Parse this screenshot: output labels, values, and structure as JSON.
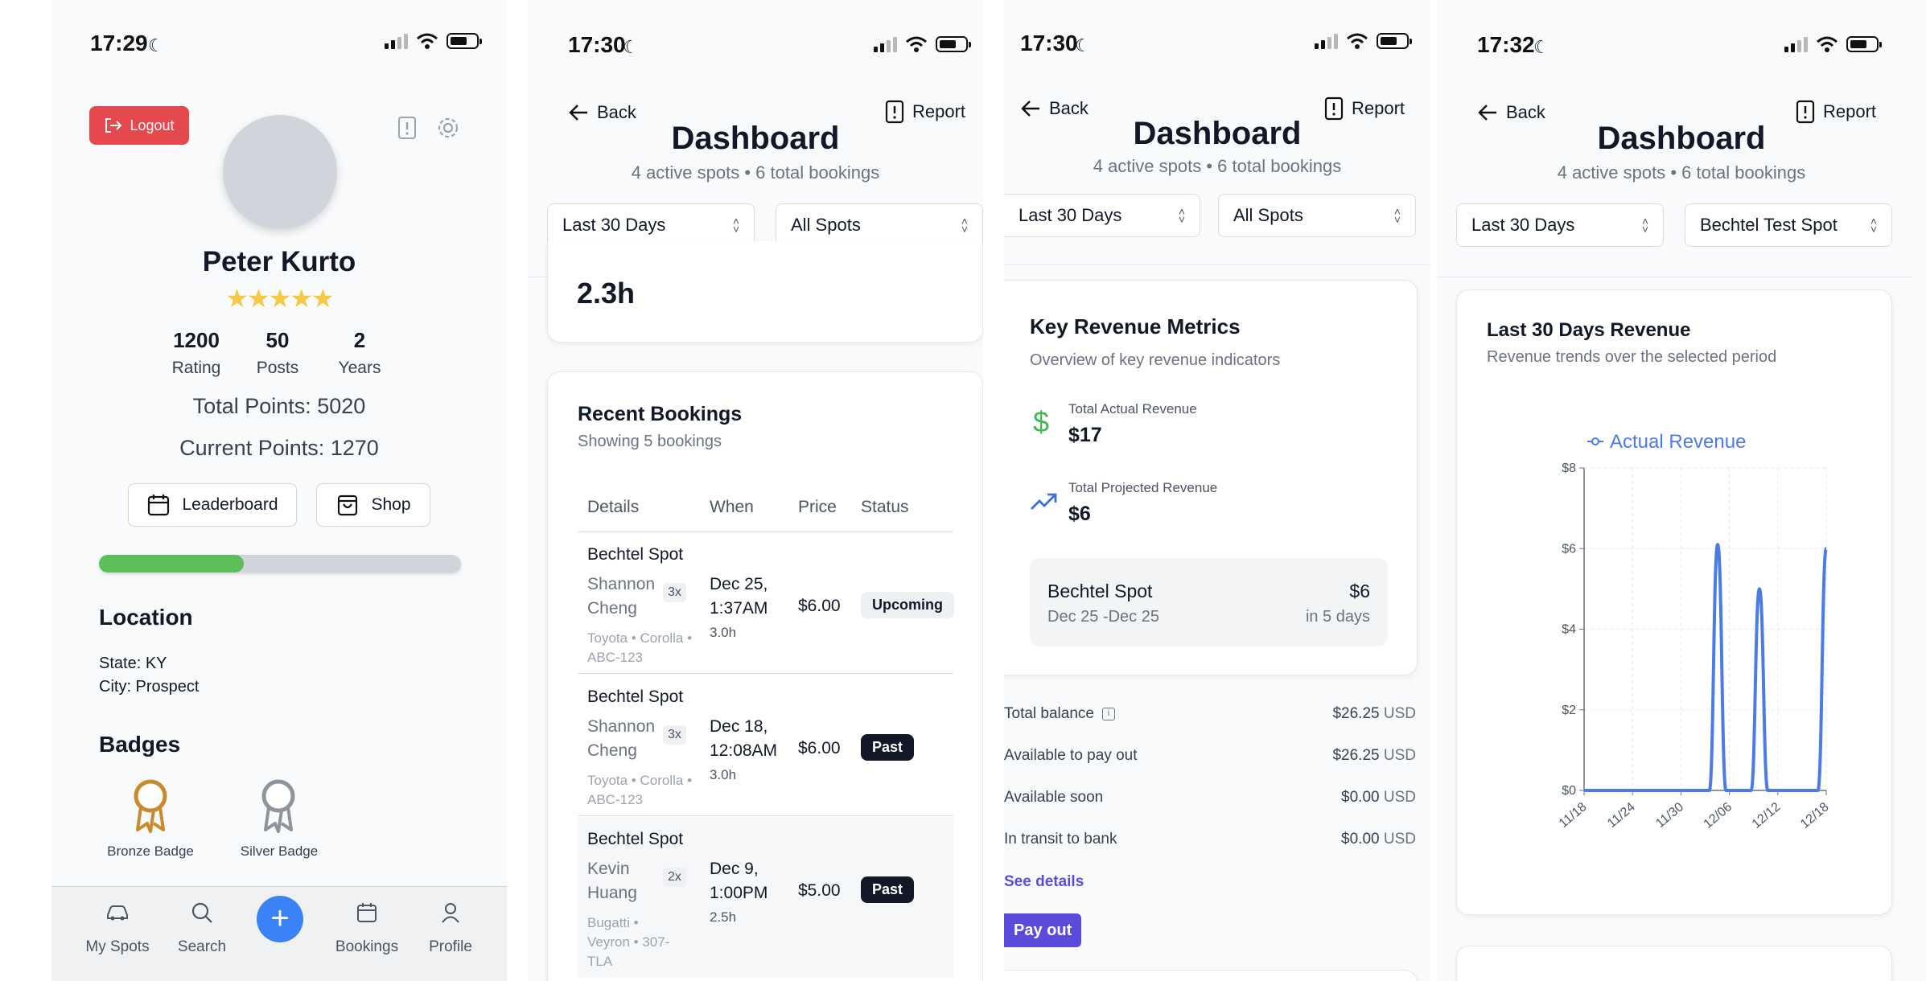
{
  "p1": {
    "time": "17:29",
    "logout": "Logout",
    "name": "Peter Kurto",
    "stars": "★★★★★",
    "stats": [
      {
        "value": "1200",
        "label": "Rating"
      },
      {
        "value": "50",
        "label": "Posts"
      },
      {
        "value": "2",
        "label": "Years"
      }
    ],
    "total_points": "Total Points: 5020",
    "current_points": "Current Points: 1270",
    "leaderboard": "Leaderboard",
    "shop": "Shop",
    "progress": 0.4,
    "location_heading": "Location",
    "state": "State: KY",
    "city": "City: Prospect",
    "badges_heading": "Badges",
    "badges": [
      "Bronze Badge",
      "Silver Badge"
    ],
    "tabs": [
      "My Spots",
      "Search",
      "Bookings",
      "Profile"
    ],
    "colors": {
      "logout": "#e5484d",
      "progress": "#5cbf5a",
      "fab": "#3b82f6",
      "star": "#f6c945"
    }
  },
  "p2": {
    "time": "17:30",
    "back": "Back",
    "report": "Report",
    "title": "Dashboard",
    "subtitle": "4 active spots • 6 total bookings",
    "filter_period": "Last 30 Days",
    "filter_spot": "All Spots",
    "partial_value": "2.3h",
    "bookings_title": "Recent Bookings",
    "bookings_subtitle": "Showing 5 bookings",
    "columns": [
      "Details",
      "When",
      "Price",
      "Status"
    ],
    "rows": [
      {
        "spot": "Bechtel Spot",
        "guest": "Shannon Cheng",
        "count": "3x",
        "car": "Toyota • Corolla • ABC-123",
        "when": "Dec 25, 1:37AM",
        "duration": "3.0h",
        "price": "$6.00",
        "status": "Upcoming"
      },
      {
        "spot": "Bechtel Spot",
        "guest": "Shannon Cheng",
        "count": "3x",
        "car": "Toyota • Corolla • ABC-123",
        "when": "Dec 18, 12:08AM",
        "duration": "3.0h",
        "price": "$6.00",
        "status": "Past"
      },
      {
        "spot": "Bechtel Spot",
        "guest": "Kevin Huang",
        "count": "2x",
        "car": "Bugatti • Veyron • 307-TLA",
        "when": "Dec 9, 1:00PM",
        "duration": "2.5h",
        "price": "$5.00",
        "status": "Past"
      }
    ]
  },
  "p3": {
    "time": "17:30",
    "back": "Back",
    "report": "Report",
    "title": "Dashboard",
    "subtitle": "4 active spots • 6 total bookings",
    "filter_period": "Last 30 Days",
    "filter_spot": "All Spots",
    "metrics_title": "Key Revenue Metrics",
    "metrics_subtitle": "Overview of key revenue indicators",
    "actual_label": "Total Actual Revenue",
    "actual_value": "$17",
    "projected_label": "Total Projected Revenue",
    "projected_value": "$6",
    "spot_name": "Bechtel Spot",
    "spot_amount": "$6",
    "spot_dates": "Dec 25 -Dec 25",
    "spot_in": "in 5 days",
    "balances": [
      {
        "label": "Total balance",
        "amount": "$26.25",
        "currency": "USD"
      },
      {
        "label": "Available to pay out",
        "amount": "$26.25",
        "currency": "USD"
      },
      {
        "label": "Available soon",
        "amount": "$0.00",
        "currency": "USD"
      },
      {
        "label": "In transit to bank",
        "amount": "$0.00",
        "currency": "USD"
      }
    ],
    "see_details": "See details",
    "pay_out": "Pay out",
    "colors": {
      "dollar": "#3fb950",
      "trend": "#3b6fe0",
      "link": "#5b4bdb",
      "payout": "#5b4bdb"
    }
  },
  "p4": {
    "time": "17:32",
    "back": "Back",
    "report": "Report",
    "title": "Dashboard",
    "subtitle": "4 active spots • 6 total bookings",
    "filter_period": "Last 30 Days",
    "filter_spot": "Bechtel Test Spot",
    "chart_title": "Last 30 Days Revenue",
    "chart_subtitle": "Revenue trends over the selected period"
  },
  "chart_data": {
    "type": "line",
    "title": "Last 30 Days Revenue",
    "subtitle": "Revenue trends over the selected period",
    "xlabel": "",
    "ylabel": "",
    "series": [
      {
        "name": "Actual Revenue",
        "color": "#4a7be6",
        "values": [
          0,
          0,
          0,
          0,
          0,
          0,
          0,
          0,
          0,
          0,
          0,
          0,
          0,
          0,
          0,
          0,
          6.1,
          0,
          0,
          0,
          0,
          5,
          0,
          0,
          0,
          0,
          0,
          0,
          0,
          6
        ]
      }
    ],
    "x_ticks": [
      "11/18",
      "11/24",
      "11/30",
      "12/06",
      "12/12",
      "12/18"
    ],
    "y_ticks": [
      "$0",
      "$2",
      "$4",
      "$6",
      "$8"
    ],
    "ylim": [
      0,
      8
    ],
    "grid": true,
    "legend": "top-center"
  }
}
